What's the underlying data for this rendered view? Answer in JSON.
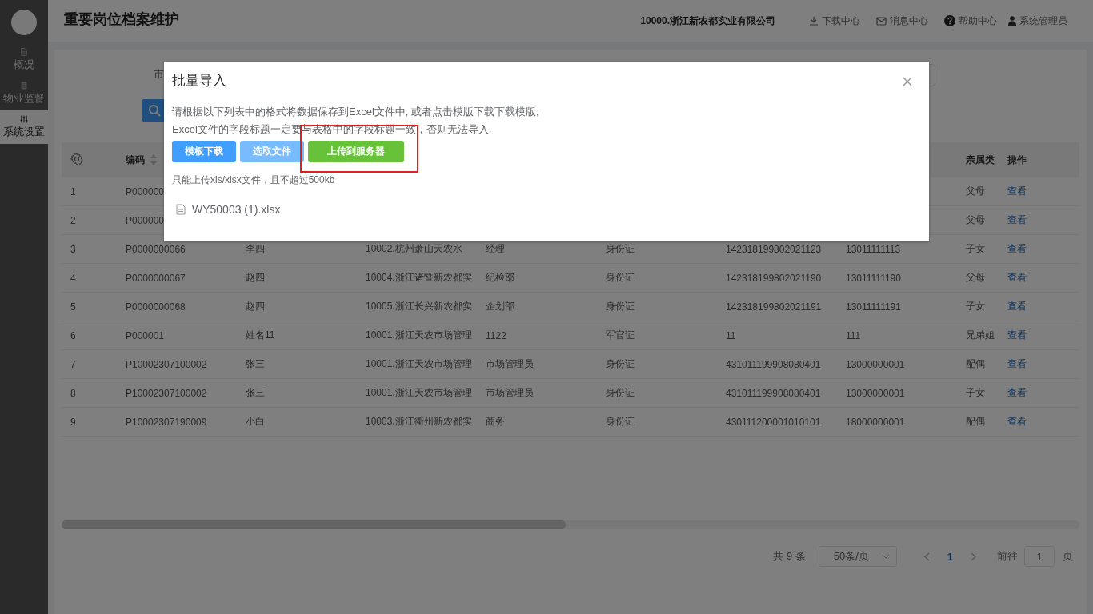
{
  "sidebar": {
    "items": [
      {
        "label": "概况",
        "kind": "doc",
        "selected": false
      },
      {
        "label": "物业监督",
        "kind": "list",
        "selected": false
      },
      {
        "label": "系统设置",
        "kind": "sliders",
        "selected": true
      }
    ]
  },
  "header": {
    "title": "重要岗位档案维护",
    "company": "10000.浙江新农都实业有限公司",
    "links": [
      {
        "label": "下载中心",
        "kind": "download"
      },
      {
        "label": "消息中心",
        "kind": "mail"
      },
      {
        "label": "帮助中心",
        "kind": "help"
      },
      {
        "label": "系统管理员",
        "kind": "user"
      }
    ]
  },
  "filter": {
    "label": "市"
  },
  "table": {
    "columns": [
      "",
      "编码",
      "",
      "",
      "",
      "",
      "",
      "",
      "亲属类",
      "操作"
    ],
    "rows": [
      [
        "1",
        "P000000",
        "",
        "",
        "",
        "",
        "",
        "",
        "父母",
        "查看"
      ],
      [
        "2",
        "P000000",
        "",
        "",
        "",
        "",
        "",
        "",
        "父母",
        "查看"
      ],
      [
        "3",
        "P0000000066",
        "李四",
        "10002.杭州萧山天农水",
        "经理",
        "身份证",
        "142318199802021123",
        "13011111113",
        "子女",
        "查看"
      ],
      [
        "4",
        "P0000000067",
        "赵四",
        "10004.浙江诸暨新农都实",
        "纪检部",
        "身份证",
        "142318199802021190",
        "13011111190",
        "父母",
        "查看"
      ],
      [
        "5",
        "P0000000068",
        "赵四",
        "10005.浙江长兴新农都实",
        "企划部",
        "身份证",
        "142318199802021191",
        "13011111191",
        "子女",
        "查看"
      ],
      [
        "6",
        "P000001",
        "姓名11",
        "10001.浙江天农市场管理",
        "1122",
        "军官证",
        "11",
        "111",
        "兄弟姐",
        "查看"
      ],
      [
        "7",
        "P10002307100002",
        "张三",
        "10001.浙江天农市场管理",
        "市场管理员",
        "身份证",
        "431011199908080401",
        "13000000001",
        "配偶",
        "查看"
      ],
      [
        "8",
        "P10002307100002",
        "张三",
        "10001.浙江天农市场管理",
        "市场管理员",
        "身份证",
        "431011199908080401",
        "13000000001",
        "子女",
        "查看"
      ],
      [
        "9",
        "P10002307190009",
        "小白",
        "10003.浙江衢州新农都实",
        "商务",
        "身份证",
        "430111200001010101",
        "18000000001",
        "配偶",
        "查看"
      ]
    ]
  },
  "pagination": {
    "total": "共 9 条",
    "page_size": "50条/页",
    "pages": [
      {
        "label": "1",
        "selected": true
      }
    ],
    "goto_label": "前往",
    "goto_value": "1",
    "goto_suffix": "页"
  },
  "dialog": {
    "title": "批量导入",
    "lines": [
      "请根据以下列表中的格式将数据保存到Excel文件中, 或者点击模版下载下载模版;",
      "Excel文件的字段标题一定要与表格中的字段标题一致，否则无法导入."
    ],
    "buttons": [
      {
        "label": "模板下载",
        "kind": "primary"
      },
      {
        "label": "选取文件",
        "kind": "muted"
      },
      {
        "label": "上传到服务器",
        "kind": "success",
        "highlighted": true
      }
    ],
    "hint": "只能上传xls/xlsx文件，且不超过500kb",
    "files": [
      "WY50003 (1).xlsx"
    ]
  }
}
